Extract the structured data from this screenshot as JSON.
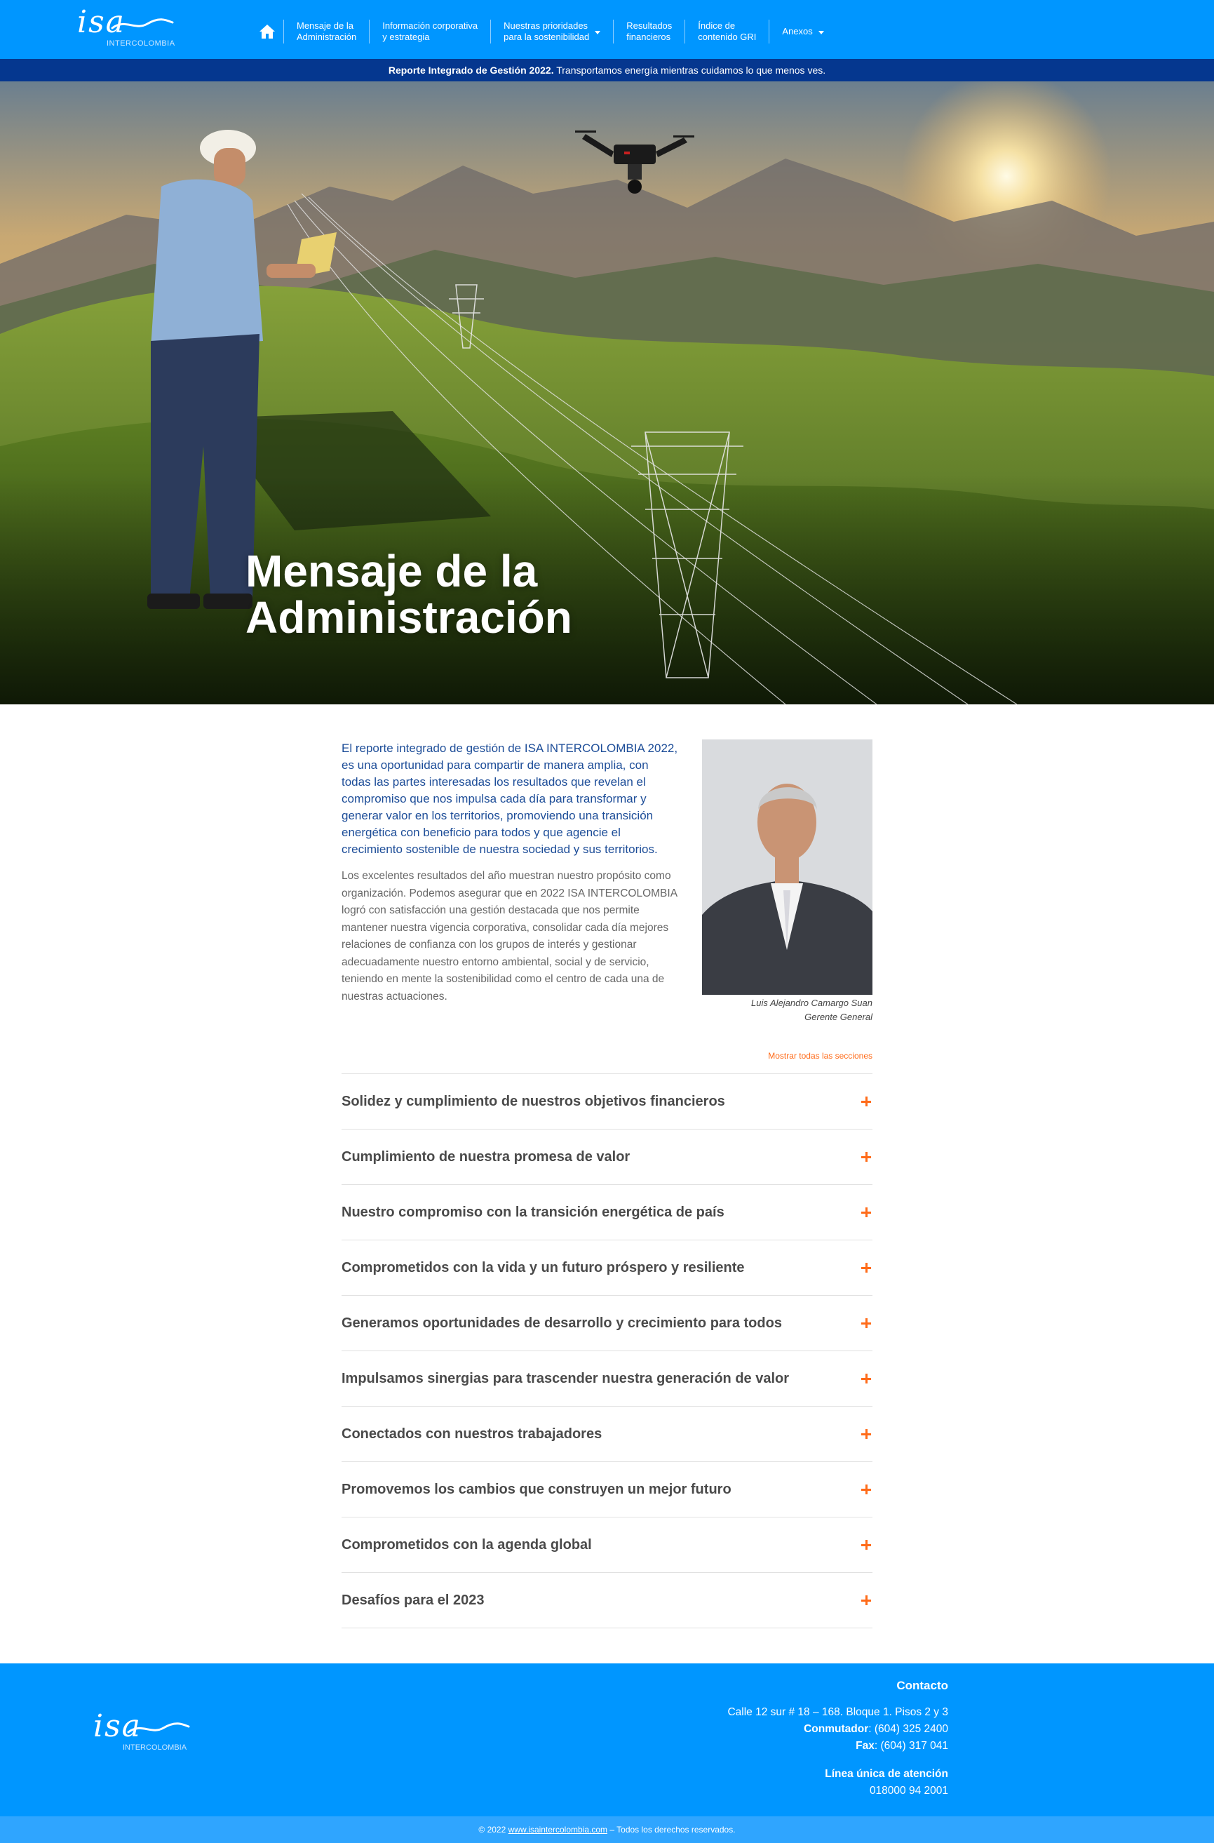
{
  "header": {
    "logo_text": "isa",
    "logo_sub": "INTERCOLOMBIA",
    "nav": [
      {
        "label": "Mensaje de la\nAdministración",
        "dropdown": false
      },
      {
        "label": "Información corporativa\ny estrategia",
        "dropdown": false
      },
      {
        "label": "Nuestras prioridades\npara la sostenibilidad",
        "dropdown": true
      },
      {
        "label": "Resultados\nfinancieros",
        "dropdown": false
      },
      {
        "label": "Índice de\ncontenido GRI",
        "dropdown": false
      },
      {
        "label": "Anexos",
        "dropdown": true
      }
    ],
    "home_icon": "home-icon"
  },
  "banner": {
    "bold": "Reporte Integrado de Gestión 2022.",
    "text": " Transportamos energía mientras cuidamos lo que menos ves."
  },
  "hero": {
    "title": "Mensaje de la\nAdministración"
  },
  "intro": {
    "lead": "El reporte integrado de gestión de ISA INTERCOLOMBIA 2022, es una oportunidad para compartir de manera amplia, con todas las partes interesadas los resultados que revelan el compromiso que nos impulsa cada día para transformar y generar valor en los territorios, promoviendo una transición energética con beneficio para todos y que agencie el crecimiento sostenible de nuestra sociedad y sus territorios.",
    "body": "Los excelentes resultados del año muestran nuestro propósito como organización. Podemos asegurar que en 2022 ISA INTERCOLOMBIA logró con satisfacción una gestión destacada que nos permite mantener nuestra vigencia corporativa, consolidar cada día mejores relaciones de confianza con los grupos de interés y gestionar adecuadamente nuestro entorno ambiental, social y de servicio, teniendo en mente la sostenibilidad como el centro de cada una de nuestras actuaciones."
  },
  "portrait": {
    "name": "Luis Alejandro Camargo Suan",
    "role": "Gerente General"
  },
  "accordion": {
    "show_all": "Mostrar todas las secciones",
    "items": [
      "Solidez y cumplimiento de nuestros objetivos financieros",
      "Cumplimiento de nuestra promesa de valor",
      "Nuestro compromiso con la transición energética de país",
      "Comprometidos con la vida y un futuro próspero y resiliente",
      "Generamos oportunidades de desarrollo y crecimiento para todos",
      "Impulsamos sinergias para trascender nuestra generación de valor",
      "Conectados con nuestros trabajadores",
      "Promovemos los cambios que construyen un mejor futuro",
      "Comprometidos con la agenda global",
      "Desafíos para el 2023"
    ]
  },
  "footer": {
    "logo_text": "isa",
    "logo_sub": "INTERCOLOMBIA",
    "contact_title": "Contacto",
    "address": "Calle 12 sur # 18 – 168. Bloque 1. Pisos 2 y 3",
    "switch_label": "Conmutador",
    "switch_value": ": (604) 325 2400",
    "fax_label": "Fax",
    "fax_value": ": (604) 317 041",
    "line_label": "Línea única de atención",
    "line_value": "018000 94 2001",
    "copyright_pre": "© 2022 ",
    "copyright_link": "www.isaintercolombia.com",
    "copyright_post": " – Todos los derechos reservados."
  },
  "colors": {
    "header_blue": "#0096ff",
    "banner_navy": "#05378f",
    "lead_blue": "#1d4d98",
    "accent_orange": "#ff6b19"
  }
}
